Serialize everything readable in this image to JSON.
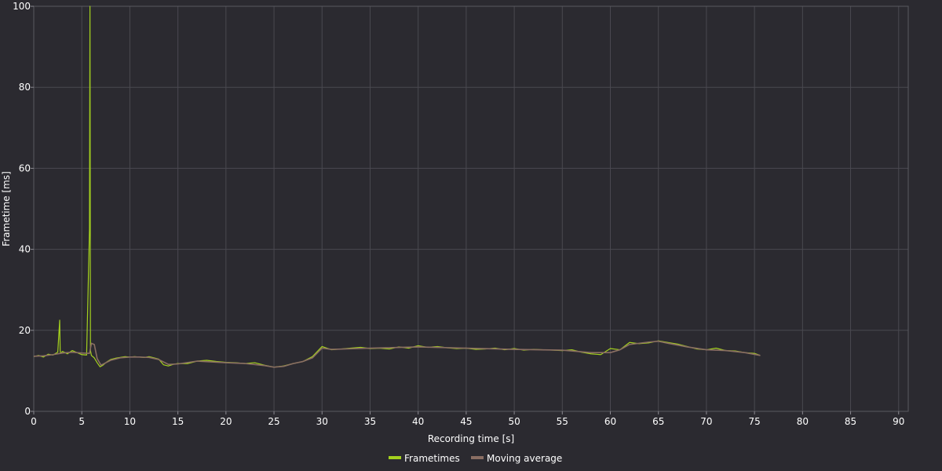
{
  "chart_data": {
    "type": "line",
    "xlabel": "Recording time [s]",
    "ylabel": "Frametime [ms]",
    "xlim": [
      0,
      91
    ],
    "ylim": [
      0,
      100
    ],
    "x_ticks": [
      0,
      5,
      10,
      15,
      20,
      25,
      30,
      35,
      40,
      45,
      50,
      55,
      60,
      65,
      70,
      75,
      80,
      85,
      90
    ],
    "y_ticks": [
      0,
      20,
      40,
      60,
      80,
      100
    ],
    "grid": true,
    "legend_position": "bottom-center",
    "colors": {
      "background": "#2b2a30",
      "grid": "#4a4950",
      "frametimes": "#a4d11e",
      "moving_average": "#8a6e63"
    },
    "series": [
      {
        "name": "Frametimes",
        "x": [
          0,
          0.5,
          1,
          1.5,
          2,
          2.5,
          2.7,
          2.75,
          2.8,
          3,
          3.5,
          4,
          4.5,
          5,
          5.5,
          5.8,
          5.85,
          5.9,
          6,
          6.3,
          6.6,
          6.9,
          7.2,
          7.6,
          8,
          8.5,
          9,
          9.5,
          10,
          10.5,
          11,
          11.5,
          12,
          12.5,
          13,
          13.5,
          14,
          14.5,
          15,
          16,
          17,
          18,
          19,
          20,
          21,
          22,
          23,
          24,
          25,
          26,
          27,
          28,
          29,
          30,
          31,
          32,
          33,
          34,
          35,
          36,
          37,
          38,
          39,
          40,
          41,
          42,
          43,
          44,
          45,
          46,
          47,
          48,
          49,
          50,
          51,
          52,
          53,
          54,
          55,
          56,
          57,
          58,
          59,
          60,
          61,
          62,
          63,
          64,
          65,
          66,
          67,
          68,
          69,
          70,
          71,
          72,
          73,
          74,
          75,
          75.6
        ],
        "y": [
          13.5,
          13.8,
          13.4,
          14.1,
          13.9,
          14.6,
          22.5,
          15.0,
          14.3,
          14.8,
          14.2,
          15.0,
          14.5,
          14.0,
          13.9,
          45.0,
          100,
          15.0,
          13.8,
          13.2,
          12.0,
          11.0,
          11.4,
          12.2,
          12.8,
          13.1,
          13.3,
          13.5,
          13.4,
          13.5,
          13.4,
          13.3,
          13.5,
          13.2,
          12.9,
          11.5,
          11.2,
          11.6,
          11.8,
          11.8,
          12.4,
          12.6,
          12.3,
          12.1,
          12.0,
          11.8,
          12.0,
          11.4,
          10.9,
          11.2,
          11.8,
          12.3,
          13.5,
          16.0,
          15.2,
          15.4,
          15.6,
          15.8,
          15.5,
          15.6,
          15.4,
          15.9,
          15.6,
          16.2,
          15.8,
          16.0,
          15.7,
          15.5,
          15.6,
          15.3,
          15.4,
          15.6,
          15.2,
          15.5,
          15.1,
          15.3,
          15.2,
          15.1,
          15.0,
          15.2,
          14.6,
          14.2,
          14.0,
          15.5,
          15.2,
          17.0,
          16.7,
          16.9,
          17.4,
          17.0,
          16.6,
          16.0,
          15.4,
          15.2,
          15.6,
          15.0,
          14.9,
          14.5,
          14.3,
          13.8
        ]
      },
      {
        "name": "Moving average",
        "x": [
          0,
          1,
          2,
          3,
          4,
          5,
          5.8,
          6.0,
          6.3,
          6.6,
          7,
          8,
          9,
          10,
          11,
          12,
          13,
          14,
          15,
          17,
          20,
          22,
          24,
          25,
          26,
          27,
          28,
          29,
          30,
          31,
          35,
          40,
          45,
          50,
          55,
          58,
          60,
          61,
          62,
          64,
          65,
          66,
          68,
          70,
          72,
          74,
          75.6
        ],
        "y": [
          13.6,
          13.7,
          14.0,
          14.4,
          14.6,
          14.4,
          14.3,
          16.8,
          16.5,
          13.0,
          11.4,
          12.6,
          13.2,
          13.4,
          13.4,
          13.3,
          12.8,
          11.6,
          11.7,
          12.4,
          12.0,
          11.8,
          11.3,
          10.9,
          11.1,
          11.8,
          12.3,
          13.2,
          15.6,
          15.3,
          15.6,
          15.9,
          15.6,
          15.3,
          15.1,
          14.5,
          14.5,
          15.2,
          16.5,
          17.1,
          17.3,
          16.8,
          15.9,
          15.2,
          15.0,
          14.5,
          13.8
        ]
      }
    ]
  }
}
